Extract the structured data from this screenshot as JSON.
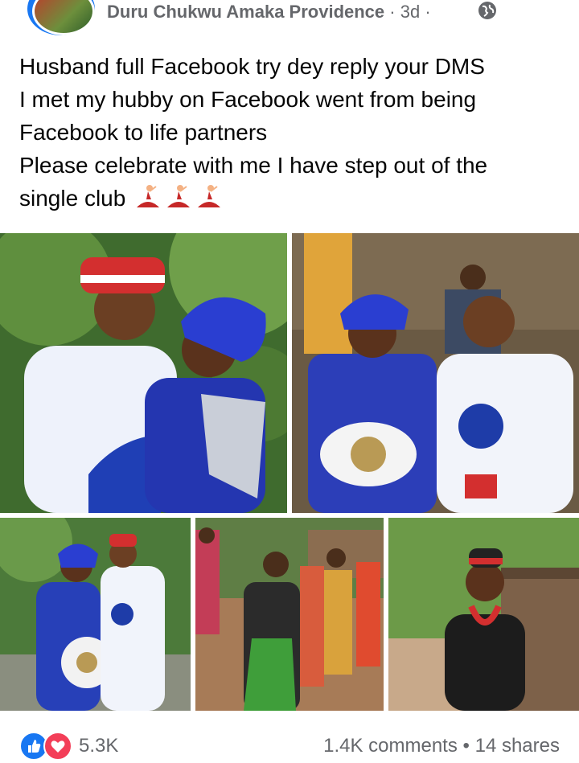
{
  "post": {
    "author": "Duru Chukwu Amaka Providence",
    "time": "3d",
    "separator": "·",
    "lines": [
      "Husband full Facebook try dey reply your DMS",
      "I met my hubby on Facebook  went from being",
      "Facebook to life partners",
      "Please celebrate with me I have step out of the",
      "single club"
    ],
    "emoji": [
      "dancer-emoji",
      "dancer-emoji",
      "dancer-emoji"
    ],
    "privacy_icon": "globe-icon"
  },
  "photos": [
    {
      "name": "couple-portrait-photo"
    },
    {
      "name": "couple-seated-photo"
    },
    {
      "name": "couple-standing-photo"
    },
    {
      "name": "dancing-crowd-photo"
    },
    {
      "name": "bride-portrait-photo"
    }
  ],
  "reactions": {
    "icons": [
      "like-icon",
      "love-icon"
    ],
    "count": "5.3K",
    "comments": "1.4K comments",
    "dot": "•",
    "shares": "14 shares"
  },
  "colors": {
    "meta_gray": "#65676b",
    "text": "#050505",
    "facebook_blue": "#1877f2",
    "love_red": "#f33e58"
  }
}
